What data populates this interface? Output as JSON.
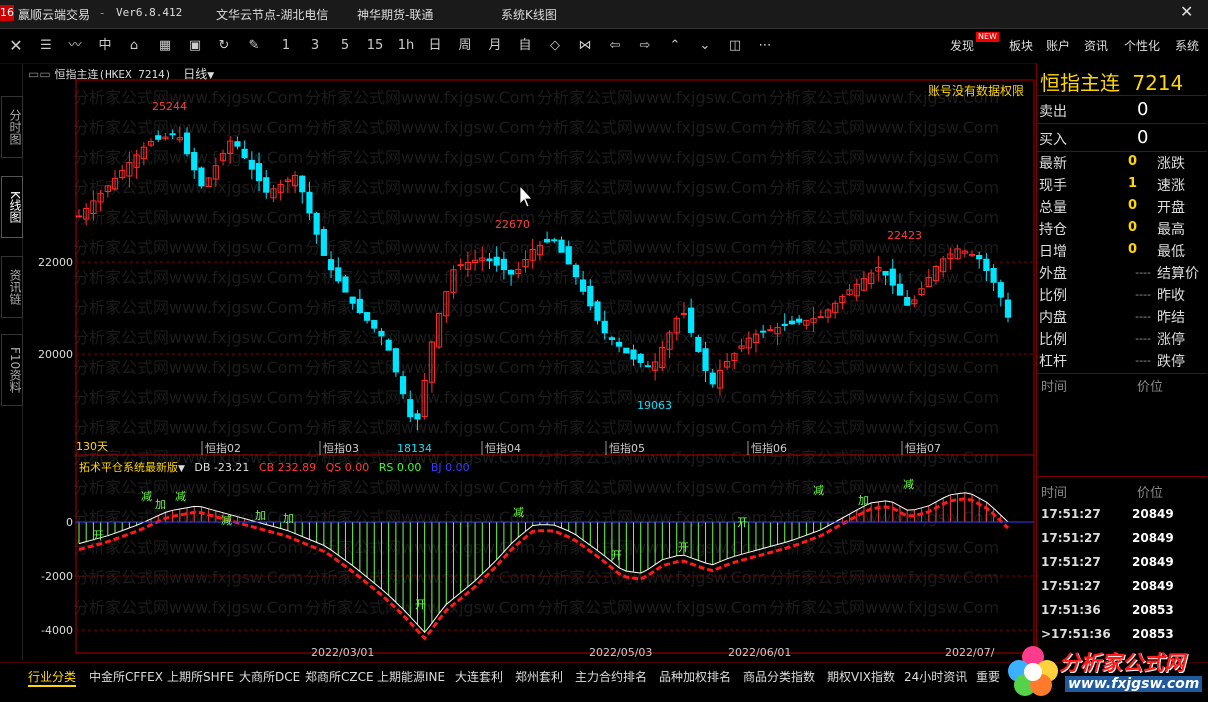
{
  "titlebar": {
    "app_name": "赢顺云端交易",
    "version": "Ver6.8.412",
    "node": "文华云节点-湖北电信",
    "broker": "神华期货-联通",
    "window_title": "系统K线图"
  },
  "toolbar": {
    "periods": [
      "1",
      "3",
      "5",
      "15",
      "1h",
      "日",
      "周",
      "月",
      "自"
    ],
    "right": [
      "发现",
      "板块",
      "账户",
      "资讯",
      "个性化",
      "系统"
    ],
    "new_badge": "NEW"
  },
  "sidetabs": [
    "分时图",
    "K线图",
    "资讯链",
    "F10资料"
  ],
  "chart": {
    "header_name": "恒指主连(HKEX 7214)",
    "period_label": "日线",
    "no_permission": "账号没有数据权限",
    "watermark": "分析家公式网www.fxjgsw.Com",
    "price_labels": [
      "22000",
      "20000"
    ],
    "peak_labels": [
      "25244",
      "22670",
      "22423",
      "19063",
      "18134"
    ],
    "days_label": "130天",
    "month_labels": [
      "恒指02",
      "恒指03",
      "恒指04",
      "恒指05",
      "恒指06",
      "恒指07"
    ],
    "colors": {
      "up": "#ff2b2b",
      "down": "#00e5ff",
      "grid": "#7a0000",
      "axis": "#b00000"
    }
  },
  "indicator": {
    "name": "拓术平仓系统最新版",
    "db": "DB -23.21",
    "cb": "CB 232.89",
    "qs": "QS 0.00",
    "rs": "RS 0.00",
    "bj": "BJ 0.00",
    "y_labels": [
      "0",
      "-2000",
      "-4000"
    ],
    "signal_jian": "减",
    "signal_jia": "加",
    "signal_kai": "开"
  },
  "date_axis": [
    "2022/03/01",
    "2022/05/03",
    "2022/06/01",
    "2022/07/"
  ],
  "right_panel": {
    "title": "恒指主连",
    "code": "7214",
    "sell_label": "卖出",
    "sell_value": "0",
    "buy_label": "买入",
    "buy_value": "0",
    "rows": [
      {
        "l": "最新",
        "v": "0",
        "r": "涨跌"
      },
      {
        "l": "现手",
        "v": "1",
        "r": "速涨"
      },
      {
        "l": "总量",
        "v": "0",
        "r": "开盘"
      },
      {
        "l": "持仓",
        "v": "0",
        "r": "最高"
      },
      {
        "l": "日增",
        "v": "0",
        "r": "最低"
      },
      {
        "l": "外盘",
        "v": "----",
        "r": "结算价"
      },
      {
        "l": "比例",
        "v": "----",
        "r": "昨收"
      },
      {
        "l": "内盘",
        "v": "----",
        "r": "昨结"
      },
      {
        "l": "比例",
        "v": "----",
        "r": "涨停"
      },
      {
        "l": "杠杆",
        "v": "----",
        "r": "跌停"
      }
    ],
    "time_header": "时间",
    "price_header": "价位",
    "ticks": [
      {
        "t": "17:51:27",
        "p": "20849"
      },
      {
        "t": "17:51:27",
        "p": "20849"
      },
      {
        "t": "17:51:27",
        "p": "20849"
      },
      {
        "t": "17:51:27",
        "p": "20849"
      },
      {
        "t": "17:51:36",
        "p": "20853"
      },
      {
        "t": ">17:51:36",
        "p": "20853"
      }
    ]
  },
  "bottom_tabs": [
    "行业分类",
    "中金所CFFEX",
    "上期所SHFE",
    "大商所DCE",
    "郑商所CZCE",
    "上期能源INE",
    "大连套利",
    "郑州套利",
    "主力合约排名",
    "品种加权排名",
    "商品分类指数",
    "期权VIX指数",
    "24小时资讯",
    "重要"
  ],
  "logo": {
    "text": "分析家公式网",
    "url": "www.fxjgsw.com"
  }
}
